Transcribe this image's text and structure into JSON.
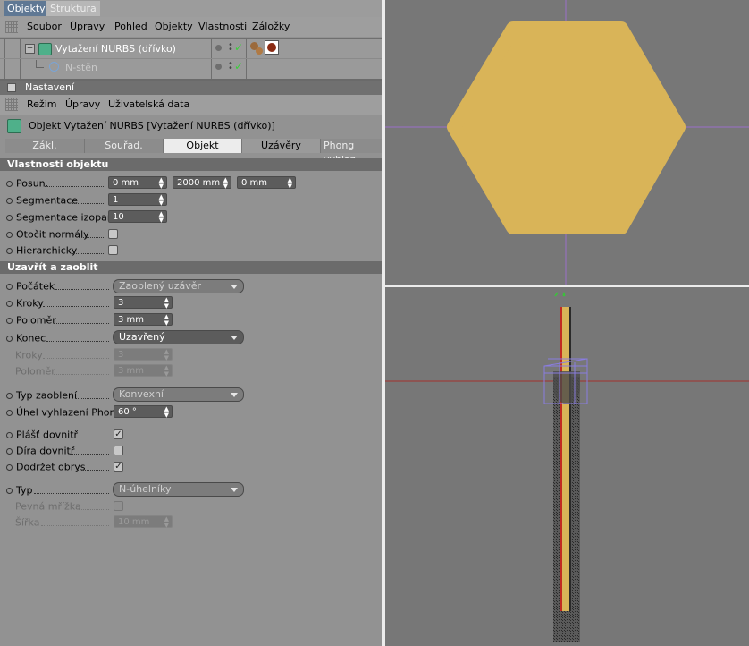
{
  "manager_tabs": [
    "Objekty",
    "Struktura"
  ],
  "menu": [
    "Soubor",
    "Úpravy",
    "Pohled",
    "Objekty",
    "Vlastnosti",
    "Záložky"
  ],
  "objects": [
    {
      "name": "Vytažení NURBS (dřívko)"
    },
    {
      "name": "N-stěn"
    }
  ],
  "attr_panel": {
    "title": "Nastavení",
    "menu": [
      "Režim",
      "Úpravy",
      "Uživatelská data"
    ],
    "object_title": "Objekt Vytažení NURBS [Vytažení NURBS (dřívko)]",
    "tabs": [
      "Zákl.",
      "Souřad.",
      "Objekt",
      "Uzávěry",
      "Phong vyhlaz"
    ],
    "active_tab": "Objekt"
  },
  "section1": {
    "title": "Vlastnosti objektu",
    "posun_label": "Posun.",
    "posun": [
      "0 mm",
      "2000 mm",
      "0 mm"
    ],
    "segmentace_label": "Segmentace",
    "segmentace": "1",
    "izoparm_label": "Segmentace izoparm",
    "izoparm": "10",
    "otocit_label": "Otočit normály",
    "hierarchicky_label": "Hierarchicky"
  },
  "section2": {
    "title": "Uzavřít a zaoblit",
    "pocatek_label": "Počátek",
    "pocatek": "Zaoblený uzávěr",
    "kroky_label": "Kroky",
    "kroky": "3",
    "polomer_label": "Poloměr",
    "polomer": "3 mm",
    "konec_label": "Konec",
    "konec": "Uzavřený",
    "kroky2_label": "Kroky",
    "kroky2": "3",
    "polomer2_label": "Poloměr",
    "polomer2": "3 mm",
    "typ_zaobleni_label": "Typ zaoblení",
    "typ_zaobleni": "Konvexní",
    "phong_label": "Úhel vyhlazení Phong",
    "phong": "60 °",
    "plast_label": "Plášť dovnitř",
    "dira_label": "Díra dovnitř",
    "obrys_label": "Dodržet obrys",
    "typ_label": "Typ",
    "typ": "N-úhelníky",
    "pevna_label": "Pevná mřížka",
    "sirka_label": "Šířka",
    "sirka": "10 mm"
  },
  "colors": {
    "hexagon": "#d9b458",
    "viewport_bg": "#777777",
    "tab_active": "#5f7894"
  }
}
